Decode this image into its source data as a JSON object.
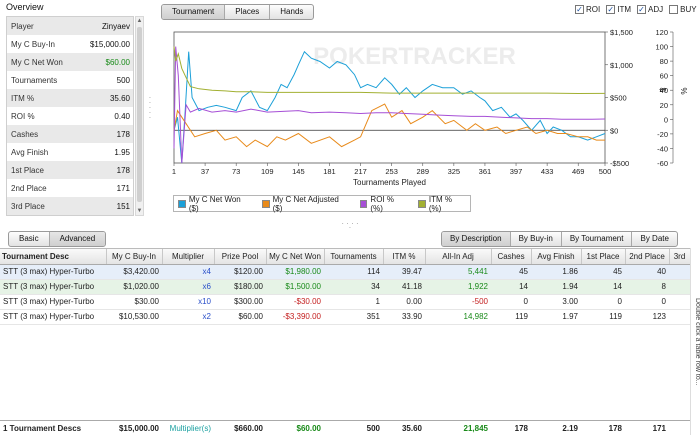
{
  "overview": {
    "title": "Overview",
    "rows": [
      {
        "key": "Player",
        "value": "Zinyaev",
        "color": "#111111"
      },
      {
        "key": "My C Buy-In",
        "value": "$15,000.00",
        "color": "#111111"
      },
      {
        "key": "My C Net Won",
        "value": "$60.00",
        "color": "#198a19"
      },
      {
        "key": "Tournaments",
        "value": "500",
        "color": "#111111"
      },
      {
        "key": "ITM %",
        "value": "35.60",
        "color": "#111111"
      },
      {
        "key": "ROI %",
        "value": "0.40",
        "color": "#111111"
      },
      {
        "key": "Cashes",
        "value": "178",
        "color": "#111111"
      },
      {
        "key": "Avg Finish",
        "value": "1.95",
        "color": "#111111"
      },
      {
        "key": "1st Place",
        "value": "178",
        "color": "#111111"
      },
      {
        "key": "2nd Place",
        "value": "171",
        "color": "#111111"
      },
      {
        "key": "3rd Place",
        "value": "151",
        "color": "#111111"
      }
    ]
  },
  "chart_tabs": [
    "Tournament",
    "Places",
    "Hands"
  ],
  "legend_checks": [
    {
      "label": "ROI",
      "checked": true
    },
    {
      "label": "ITM",
      "checked": true
    },
    {
      "label": "ADJ",
      "checked": true
    },
    {
      "label": "BUY",
      "checked": false
    }
  ],
  "chart_data": {
    "type": "line",
    "xlabel": "Tournaments Played",
    "x_ticks": [
      "1",
      "37",
      "73",
      "109",
      "145",
      "181",
      "217",
      "253",
      "289",
      "325",
      "361",
      "397",
      "433",
      "469",
      "500"
    ],
    "y_left": {
      "label": "$",
      "ticks": [
        "$1,500",
        "$1,000",
        "$500",
        "$0",
        "-$500"
      ],
      "range": [
        -500,
        1500
      ]
    },
    "y_right": {
      "label": "%",
      "ticks": [
        "120",
        "100",
        "80",
        "60",
        "40",
        "20",
        "0",
        "-20",
        "-40",
        "-60"
      ],
      "range": [
        -60,
        120
      ]
    },
    "watermark": "POKERTRACKER",
    "series": [
      {
        "name": "My C Net Won ($)",
        "color": "#1ca0d8",
        "points": [
          [
            1,
            0
          ],
          [
            5,
            200
          ],
          [
            10,
            -500
          ],
          [
            14,
            300
          ],
          [
            18,
            1200
          ],
          [
            22,
            500
          ],
          [
            30,
            300
          ],
          [
            40,
            350
          ],
          [
            50,
            380
          ],
          [
            60,
            350
          ],
          [
            73,
            300
          ],
          [
            80,
            500
          ],
          [
            90,
            600
          ],
          [
            100,
            350
          ],
          [
            109,
            300
          ],
          [
            118,
            500
          ],
          [
            125,
            700
          ],
          [
            132,
            650
          ],
          [
            140,
            850
          ],
          [
            145,
            1000
          ],
          [
            152,
            1200
          ],
          [
            160,
            1100
          ],
          [
            170,
            1050
          ],
          [
            181,
            950
          ],
          [
            190,
            1050
          ],
          [
            200,
            1000
          ],
          [
            210,
            850
          ],
          [
            217,
            650
          ],
          [
            225,
            700
          ],
          [
            235,
            650
          ],
          [
            245,
            800
          ],
          [
            253,
            700
          ],
          [
            262,
            550
          ],
          [
            270,
            650
          ],
          [
            280,
            500
          ],
          [
            289,
            600
          ],
          [
            300,
            700
          ],
          [
            312,
            650
          ],
          [
            325,
            650
          ],
          [
            335,
            550
          ],
          [
            345,
            600
          ],
          [
            355,
            500
          ],
          [
            361,
            450
          ],
          [
            370,
            300
          ],
          [
            380,
            350
          ],
          [
            390,
            200
          ],
          [
            397,
            250
          ],
          [
            405,
            150
          ],
          [
            415,
            0
          ],
          [
            425,
            150
          ],
          [
            433,
            -50
          ],
          [
            440,
            50
          ],
          [
            450,
            0
          ],
          [
            460,
            -100
          ],
          [
            469,
            -100
          ],
          [
            480,
            -150
          ],
          [
            490,
            -100
          ],
          [
            500,
            -50
          ]
        ]
      },
      {
        "name": "My C Net Adjusted ($)",
        "color": "#e88a1a",
        "points": [
          [
            1,
            0
          ],
          [
            5,
            300
          ],
          [
            10,
            200
          ],
          [
            15,
            100
          ],
          [
            25,
            -100
          ],
          [
            37,
            -50
          ],
          [
            50,
            0
          ],
          [
            60,
            -150
          ],
          [
            73,
            -100
          ],
          [
            85,
            -250
          ],
          [
            95,
            -150
          ],
          [
            109,
            -250
          ],
          [
            120,
            -100
          ],
          [
            130,
            -150
          ],
          [
            145,
            -50
          ],
          [
            160,
            -200
          ],
          [
            181,
            -100
          ],
          [
            195,
            -250
          ],
          [
            210,
            -150
          ],
          [
            217,
            -100
          ],
          [
            230,
            300
          ],
          [
            245,
            400
          ],
          [
            253,
            200
          ],
          [
            265,
            300
          ],
          [
            275,
            100
          ],
          [
            289,
            200
          ],
          [
            300,
            300
          ],
          [
            315,
            100
          ],
          [
            325,
            150
          ],
          [
            340,
            0
          ],
          [
            350,
            100
          ],
          [
            361,
            0
          ],
          [
            375,
            50
          ],
          [
            385,
            -50
          ],
          [
            397,
            0
          ],
          [
            410,
            50
          ],
          [
            420,
            -50
          ],
          [
            433,
            0
          ],
          [
            445,
            -50
          ],
          [
            455,
            -50
          ],
          [
            469,
            -100
          ],
          [
            480,
            -100
          ],
          [
            490,
            -150
          ],
          [
            500,
            -150
          ]
        ]
      },
      {
        "name": "ROI % (%)",
        "color": "#a64fd6",
        "points": [
          [
            1,
            -40
          ],
          [
            3,
            100
          ],
          [
            6,
            60
          ],
          [
            10,
            -60
          ],
          [
            15,
            20
          ],
          [
            20,
            10
          ],
          [
            30,
            15
          ],
          [
            45,
            10
          ],
          [
            60,
            12
          ],
          [
            73,
            10
          ],
          [
            90,
            14
          ],
          [
            109,
            10
          ],
          [
            130,
            11
          ],
          [
            145,
            12
          ],
          [
            160,
            9
          ],
          [
            181,
            10
          ],
          [
            200,
            9
          ],
          [
            217,
            8
          ],
          [
            235,
            9
          ],
          [
            253,
            9
          ],
          [
            270,
            8
          ],
          [
            289,
            7
          ],
          [
            305,
            6
          ],
          [
            325,
            5
          ],
          [
            345,
            4
          ],
          [
            361,
            4
          ],
          [
            380,
            3
          ],
          [
            397,
            2
          ],
          [
            415,
            1
          ],
          [
            433,
            1
          ],
          [
            450,
            0
          ],
          [
            469,
            0
          ],
          [
            485,
            0
          ],
          [
            500,
            0.4
          ]
        ]
      },
      {
        "name": "ITM % (%)",
        "color": "#a2b032",
        "points": [
          [
            1,
            100
          ],
          [
            3,
            80
          ],
          [
            6,
            90
          ],
          [
            10,
            70
          ],
          [
            14,
            60
          ],
          [
            20,
            45
          ],
          [
            30,
            42
          ],
          [
            45,
            40
          ],
          [
            60,
            39
          ],
          [
            73,
            38
          ],
          [
            90,
            38
          ],
          [
            109,
            37
          ],
          [
            130,
            37
          ],
          [
            145,
            37
          ],
          [
            181,
            37
          ],
          [
            217,
            37
          ],
          [
            253,
            36
          ],
          [
            289,
            36
          ],
          [
            325,
            36
          ],
          [
            361,
            36
          ],
          [
            397,
            36
          ],
          [
            433,
            36
          ],
          [
            469,
            35.5
          ],
          [
            500,
            35.6
          ]
        ]
      }
    ]
  },
  "view_tabs": [
    "Basic",
    "Advanced"
  ],
  "sort_tabs": [
    "By Description",
    "By Buy-in",
    "By Tournament",
    "By Date"
  ],
  "table": {
    "headers": [
      "Tournament Desc",
      "My C Buy-In",
      "Multiplier",
      "Prize Pool",
      "My C Net Won",
      "Tournaments",
      "ITM %",
      "All-In Adj",
      "Cashes",
      "Avg Finish",
      "1st Place",
      "2nd Place",
      "3rd"
    ],
    "rows": [
      {
        "desc": "STT (3 max) Hyper-Turbo",
        "buyin": "$3,420.00",
        "mult": "x4",
        "prize": "$120.00",
        "net": "$1,980.00",
        "net_sign": "pos",
        "tourn": "114",
        "itm": "39.47",
        "adj": "5,441",
        "adj_sign": "pos",
        "cashes": "45",
        "avg": "1.86",
        "p1": "45",
        "p2": "40",
        "p3": ""
      },
      {
        "desc": "STT (3 max) Hyper-Turbo",
        "buyin": "$1,020.00",
        "mult": "x6",
        "prize": "$180.00",
        "net": "$1,500.00",
        "net_sign": "pos",
        "tourn": "34",
        "itm": "41.18",
        "adj": "1,922",
        "adj_sign": "pos",
        "cashes": "14",
        "avg": "1.94",
        "p1": "14",
        "p2": "8",
        "p3": ""
      },
      {
        "desc": "STT (3 max) Hyper-Turbo",
        "buyin": "$30.00",
        "mult": "x10",
        "prize": "$300.00",
        "net": "-$30.00",
        "net_sign": "neg",
        "tourn": "1",
        "itm": "0.00",
        "adj": "-500",
        "adj_sign": "neg",
        "cashes": "0",
        "avg": "3.00",
        "p1": "0",
        "p2": "0",
        "p3": ""
      },
      {
        "desc": "STT (3 max) Hyper-Turbo",
        "buyin": "$10,530.00",
        "mult": "x2",
        "prize": "$60.00",
        "net": "-$3,390.00",
        "net_sign": "neg",
        "tourn": "351",
        "itm": "33.90",
        "adj": "14,982",
        "adj_sign": "pos",
        "cashes": "119",
        "avg": "1.97",
        "p1": "119",
        "p2": "123",
        "p3": ""
      }
    ],
    "totals": {
      "desc": "1 Tournament Descs",
      "buyin": "$15,000.00",
      "mult": "Multiplier(s)",
      "prize": "$660.00",
      "net": "$60.00",
      "tourn": "500",
      "itm": "35.60",
      "adj": "21,845",
      "cashes": "178",
      "avg": "2.19",
      "p1": "178",
      "p2": "171"
    },
    "side_label": "Double click a table row to..."
  }
}
